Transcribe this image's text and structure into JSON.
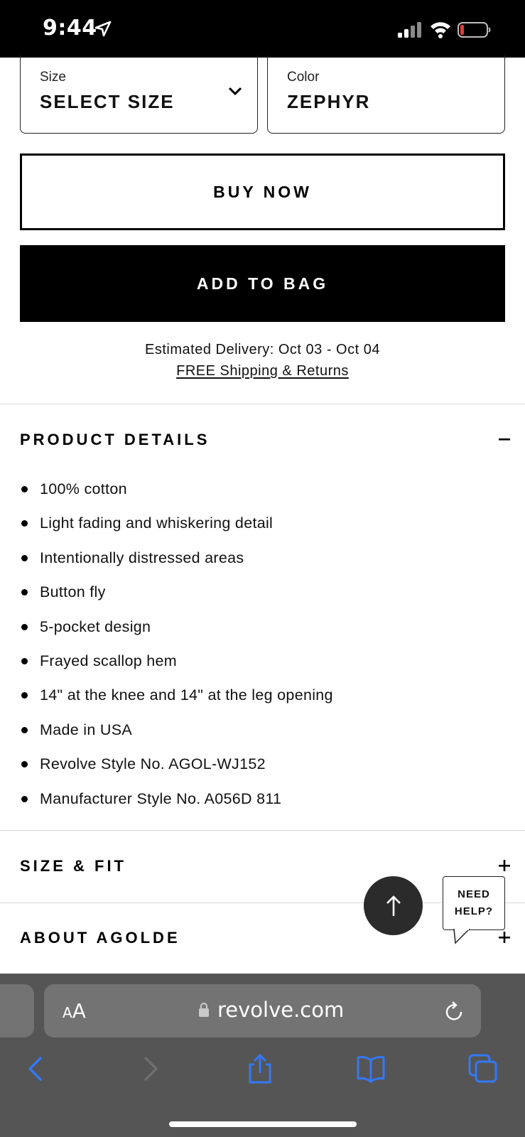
{
  "status": {
    "time": "9:44"
  },
  "selectors": {
    "size": {
      "label": "Size",
      "value": "SELECT SIZE"
    },
    "color": {
      "label": "Color",
      "value": "ZEPHYR"
    }
  },
  "actions": {
    "buy_now": "BUY NOW",
    "add_to_bag": "ADD TO BAG"
  },
  "delivery": {
    "estimate": "Estimated Delivery: Oct 03 - Oct 04",
    "shipping_link": "FREE Shipping & Returns"
  },
  "sections": {
    "product_details": {
      "title": "PRODUCT DETAILS",
      "items": [
        "100% cotton",
        "Light fading and whiskering detail",
        "Intentionally distressed areas",
        "Button fly",
        "5-pocket design",
        "Frayed scallop hem",
        "14\" at the knee and 14\" at the leg opening",
        "Made in USA",
        "Revolve Style No. AGOL-WJ152",
        "Manufacturer Style No. A056D 811"
      ]
    },
    "size_fit": {
      "title": "SIZE & FIT"
    },
    "about": {
      "title": "ABOUT AGOLDE"
    }
  },
  "help": {
    "line1": "NEED",
    "line2": "HELP?"
  },
  "browser": {
    "aa_small": "A",
    "aa_large": "A",
    "url": "revolve.com"
  },
  "colors": {
    "accent": "#3478f6",
    "button_bg": "#000000",
    "toolbar_bg": "#555555"
  }
}
